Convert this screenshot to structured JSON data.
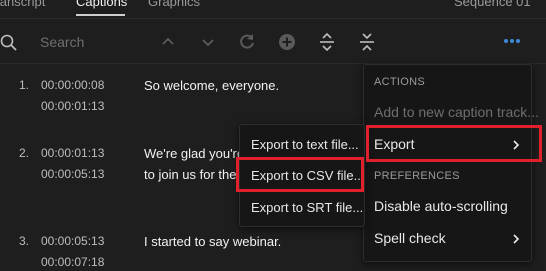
{
  "tabs": [
    {
      "label": "Transcript"
    },
    {
      "label": "Captions"
    },
    {
      "label": "Graphics"
    }
  ],
  "sequence_label": "Sequence 01",
  "search": {
    "placeholder": "Search"
  },
  "toolbar_icons": [
    "chevron-up-icon",
    "chevron-down-icon",
    "refresh-icon",
    "add-icon",
    "expand-icon",
    "collapse-icon",
    "more-icon"
  ],
  "captions": [
    {
      "num": "1.",
      "start": "00:00:00:08",
      "end": "00:00:01:13",
      "text": "So welcome, everyone."
    },
    {
      "num": "2.",
      "start": "00:00:01:13",
      "end": "00:00:05:13",
      "text_line1": "We're glad you're",
      "text_line2": "to join us for the"
    },
    {
      "num": "3.",
      "start": "00:00:05:13",
      "end": "00:00:07:18",
      "text": "I started to say webinar."
    }
  ],
  "menu": {
    "actions_header": "ACTIONS",
    "add_caption_track": "Add to new caption track...",
    "export": "Export",
    "preferences_header": "PREFERENCES",
    "disable_autoscroll": "Disable auto-scrolling",
    "spell_check": "Spell check"
  },
  "submenu": {
    "text_file": "Export to text file...",
    "csv_file": "Export to CSV file...",
    "srt_file": "Export to SRT file..."
  },
  "colors": {
    "background": "#1e1e1e",
    "menu_bg": "#161616",
    "highlight": "#e0202a",
    "accent": "#3b8ad8"
  }
}
